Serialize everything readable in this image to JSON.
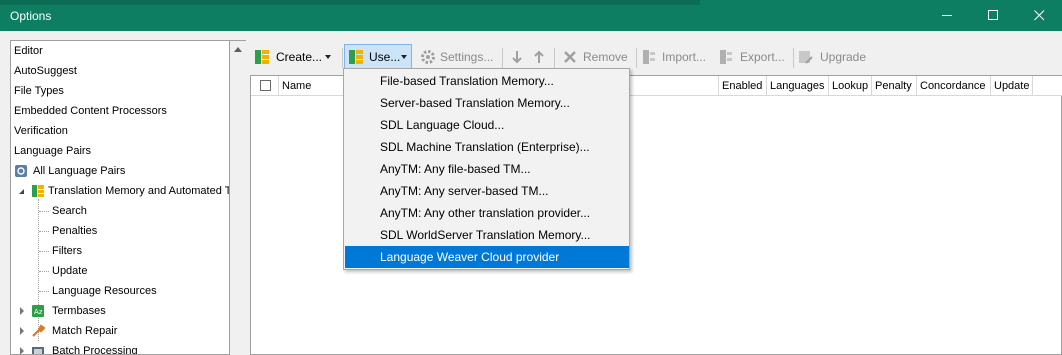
{
  "window": {
    "title": "Options",
    "minimize_icon": "minimize-icon",
    "maximize_icon": "maximize-icon",
    "close_icon": "close-icon"
  },
  "tree": {
    "items": [
      {
        "label": "Editor"
      },
      {
        "label": "AutoSuggest"
      },
      {
        "label": "File Types"
      },
      {
        "label": "Embedded Content Processors"
      },
      {
        "label": "Verification"
      },
      {
        "label": "Language Pairs"
      },
      {
        "label": "All Language Pairs"
      },
      {
        "label": "Translation Memory and Automated Translation"
      },
      {
        "label": "Search"
      },
      {
        "label": "Penalties"
      },
      {
        "label": "Filters"
      },
      {
        "label": "Update"
      },
      {
        "label": "Language Resources"
      },
      {
        "label": "Termbases"
      },
      {
        "label": "Match Repair"
      },
      {
        "label": "Batch Processing"
      }
    ]
  },
  "toolbar": {
    "create_label": "Create...",
    "use_label": "Use...",
    "settings_label": "Settings...",
    "remove_label": "Remove",
    "import_label": "Import...",
    "export_label": "Export...",
    "upgrade_label": "Upgrade"
  },
  "grid": {
    "columns": [
      "Name",
      "Enabled",
      "Languages",
      "Lookup",
      "Penalty",
      "Concordance",
      "Update"
    ]
  },
  "use_menu": {
    "items": [
      "File-based Translation Memory...",
      "Server-based Translation Memory...",
      "SDL Language Cloud...",
      "SDL Machine Translation (Enterprise)...",
      "AnyTM: Any file-based TM...",
      "AnyTM: Any server-based TM...",
      "AnyTM: Any other translation provider...",
      "SDL WorldServer Translation Memory...",
      "Language Weaver Cloud provider"
    ],
    "highlighted_index": 8
  },
  "colors": {
    "titlebar": "#0e7e62",
    "selection": "#0078d7",
    "tree_selection": "#cce8ff"
  }
}
